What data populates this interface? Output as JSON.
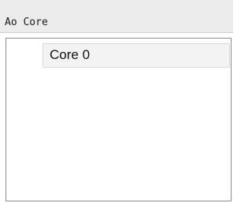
{
  "header": {
    "title": "Ao Core"
  },
  "cores": {
    "items": [
      {
        "label": "Core 0"
      }
    ]
  }
}
